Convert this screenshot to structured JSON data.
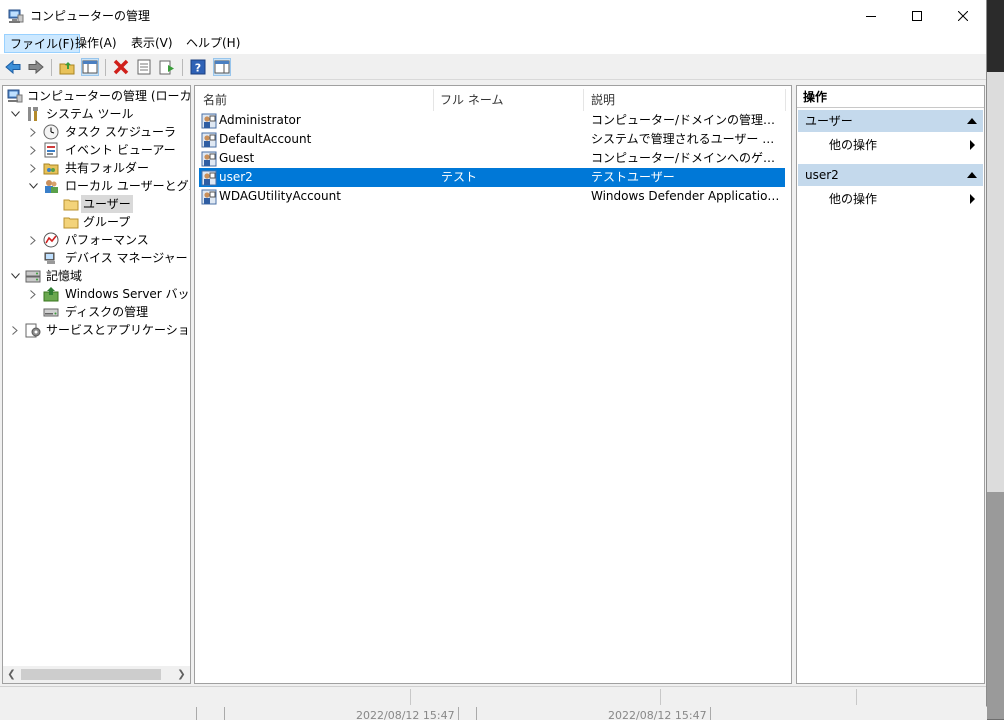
{
  "window": {
    "title": "コンピューターの管理"
  },
  "menu": [
    "ファイル(F)",
    "操作(A)",
    "表示(V)",
    "ヘルプ(H)"
  ],
  "tree": [
    {
      "label": "コンピューターの管理 (ローカル)",
      "icon": "computer-management-icon",
      "expander": ""
    },
    {
      "label": "システム ツール",
      "icon": "tools-icon",
      "expander": "expanded"
    },
    {
      "label": "タスク スケジューラ",
      "icon": "clock-icon",
      "expander": "collapsed"
    },
    {
      "label": "イベント ビューアー",
      "icon": "event-viewer-icon",
      "expander": "collapsed"
    },
    {
      "label": "共有フォルダー",
      "icon": "shared-folder-icon",
      "expander": "collapsed"
    },
    {
      "label": "ローカル ユーザーとグループ",
      "icon": "users-groups-icon",
      "expander": "expanded"
    },
    {
      "label": "ユーザー",
      "icon": "folder-icon",
      "expander": ""
    },
    {
      "label": "グループ",
      "icon": "folder-icon",
      "expander": ""
    },
    {
      "label": "パフォーマンス",
      "icon": "performance-icon",
      "expander": "collapsed"
    },
    {
      "label": "デバイス マネージャー",
      "icon": "device-manager-icon",
      "expander": ""
    },
    {
      "label": "記憶域",
      "icon": "storage-icon",
      "expander": "expanded"
    },
    {
      "label": "Windows Server バックア",
      "icon": "backup-icon",
      "expander": "collapsed"
    },
    {
      "label": "ディスクの管理",
      "icon": "disk-icon",
      "expander": ""
    },
    {
      "label": "サービスとアプリケーション",
      "icon": "services-icon",
      "expander": "collapsed"
    }
  ],
  "list": {
    "columns": [
      "名前",
      "フル ネーム",
      "説明"
    ],
    "rows": [
      {
        "name": "Administrator",
        "fullname": "",
        "desc": "コンピューター/ドメインの管理用 (ビルト..."
      },
      {
        "name": "DefaultAccount",
        "fullname": "",
        "desc": "システムで管理されるユーザー アカウン..."
      },
      {
        "name": "Guest",
        "fullname": "",
        "desc": "コンピューター/ドメインへのゲスト アクセ..."
      },
      {
        "name": "user2",
        "fullname": "テスト",
        "desc": "テストユーザー"
      },
      {
        "name": "WDAGUtilityAccount",
        "fullname": "",
        "desc": "Windows Defender Application G..."
      }
    ]
  },
  "actions": {
    "title": "操作",
    "sections": [
      {
        "title": "ユーザー",
        "items": [
          "他の操作"
        ]
      },
      {
        "title": "user2",
        "items": [
          "他の操作"
        ]
      }
    ]
  },
  "background": {
    "timestamps": [
      "2022/08/12 15:47",
      "2022/08/12 15:47"
    ]
  },
  "colors": {
    "selection": "#0078d7",
    "action_header": "#c4d9ec",
    "menu_active": "#cce8ff"
  }
}
